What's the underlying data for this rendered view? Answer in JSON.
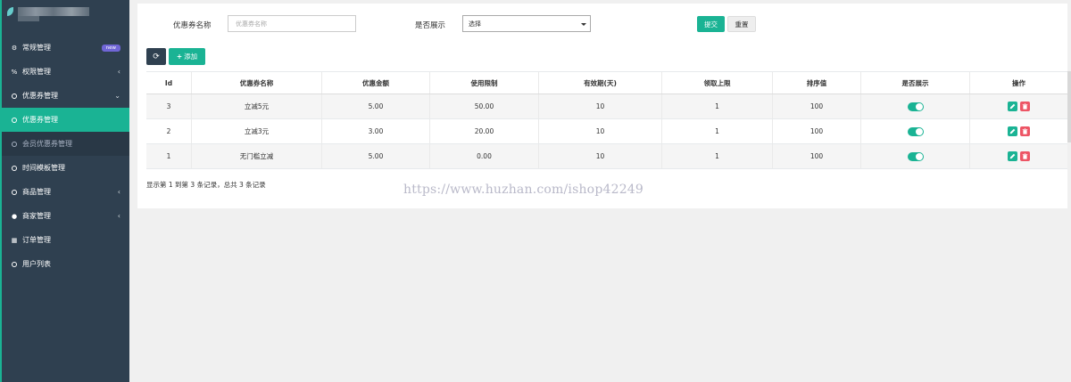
{
  "sidebar": {
    "items": [
      {
        "label": "常规管理",
        "icon": "cogs-icon",
        "badge": "new"
      },
      {
        "label": "权限管理",
        "icon": "link-icon",
        "arrow": "‹"
      },
      {
        "label": "优惠券管理",
        "icon": "circle-icon",
        "arrow": "⌄"
      },
      {
        "label": "优惠券管理",
        "icon": "circle-icon"
      },
      {
        "label": "会员优惠券管理",
        "icon": "circle-icon"
      },
      {
        "label": "时间模板管理",
        "icon": "circle-icon"
      },
      {
        "label": "商品管理",
        "icon": "circle-icon",
        "arrow": "‹"
      },
      {
        "label": "商家管理",
        "icon": "user-circle-icon",
        "arrow": "‹"
      },
      {
        "label": "订单管理",
        "icon": "calendar-icon"
      },
      {
        "label": "用户列表",
        "icon": "circle-icon"
      }
    ]
  },
  "search": {
    "name_label": "优惠券名称",
    "name_placeholder": "优惠券名称",
    "show_label": "是否展示",
    "show_value": "选择",
    "submit_label": "提交",
    "reset_label": "重置"
  },
  "toolbar": {
    "add_label": "添加"
  },
  "table": {
    "headers": [
      "Id",
      "优惠券名称",
      "优惠金额",
      "使用限制",
      "有效期(天)",
      "领取上限",
      "排序值",
      "是否展示",
      "操作"
    ],
    "rows": [
      [
        "3",
        "立减5元",
        "5.00",
        "50.00",
        "10",
        "1",
        "100"
      ],
      [
        "2",
        "立减3元",
        "3.00",
        "20.00",
        "10",
        "1",
        "100"
      ],
      [
        "1",
        "无门槛立减",
        "5.00",
        "0.00",
        "10",
        "1",
        "100"
      ]
    ],
    "show_on": [
      true,
      true,
      true
    ]
  },
  "footer": {
    "summary": "显示第 1 到第 3 条记录，总共 3 条记录"
  },
  "watermark": "https://www.huzhan.com/ishop42249",
  "colors": {
    "accent": "#1ab394",
    "sidebar_bg": "#2f4050",
    "danger": "#ed5565",
    "badge": "#7066d6"
  }
}
